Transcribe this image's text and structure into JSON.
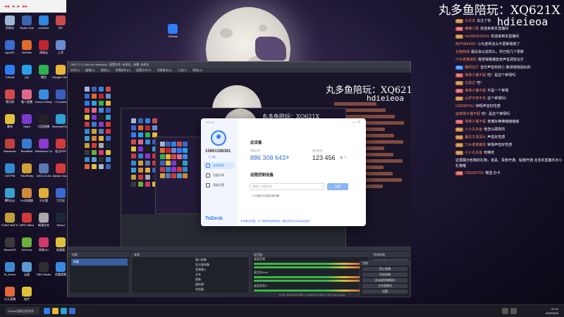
{
  "media_tab": {
    "controls": [
      "◂◂",
      "◂",
      "▸",
      "▸▸"
    ]
  },
  "wallpaper": {
    "title": "丸多鱼陪玩：XQ621X",
    "subtitle": "hdieieoa"
  },
  "desktop_icons": [
    {
      "label": "回收站",
      "color": "#9fb7d6"
    },
    {
      "label": "Studio One",
      "color": "#3c64b0"
    },
    {
      "label": "cccMeet",
      "color": "#2f85e0"
    },
    {
      "label": "MP",
      "color": "#c94c4c"
    },
    {
      "label": "ZyphRT",
      "color": "#3a6acb"
    },
    {
      "label": "WeStlm",
      "color": "#e06a2c"
    },
    {
      "label": "网易云",
      "color": "#c0262d"
    },
    {
      "label": "上传",
      "color": "#6a8bd0"
    },
    {
      "label": "ToDesk",
      "color": "#2e7cf6"
    },
    {
      "label": "QQ",
      "color": "#2aa0e8"
    },
    {
      "label": "微信",
      "color": "#2fb34e"
    },
    {
      "label": "Google Chrome",
      "color": "#e8b43a"
    },
    {
      "label": "雪天网",
      "color": "#d04a4a"
    },
    {
      "label": "看人直播",
      "color": "#e06a8b"
    },
    {
      "label": "Draw & Bluep",
      "color": "#3a8ee0"
    },
    {
      "label": "i Connect",
      "color": "#3a5fc0"
    },
    {
      "label": "雷电",
      "color": "#e0c23a"
    },
    {
      "label": "Hight",
      "color": "#7a3ad0"
    },
    {
      "label": "抖音直播",
      "color": "#222"
    },
    {
      "label": "Microsoft Edge",
      "color": "#2fa0d0"
    },
    {
      "label": "Bandicam",
      "color": "#c04040"
    },
    {
      "label": "Bandibelt",
      "color": "#3a7ad0"
    },
    {
      "label": "Bandicam Cut",
      "color": "#8a3ad0"
    },
    {
      "label": "金山PDF",
      "color": "#d03a3a"
    },
    {
      "label": "CMTPM",
      "color": "#2f8ad0"
    },
    {
      "label": "ThirdParty",
      "color": "#d0a03a"
    },
    {
      "label": "2022-10-04",
      "color": "#5a7ab0"
    },
    {
      "label": "Adobe Cloud",
      "color": "#d03a3a"
    },
    {
      "label": "腾讯QQ",
      "color": "#3aa0d0"
    },
    {
      "label": "UU加速器",
      "color": "#d08a3a"
    },
    {
      "label": "天天看",
      "color": "#e0b03a"
    },
    {
      "label": "工作宝",
      "color": "#3a6ad0"
    },
    {
      "label": "PUBG BATTLEGR",
      "color": "#c0a03a"
    },
    {
      "label": "WPS Office",
      "color": "#d03a3a"
    },
    {
      "label": "新建文本",
      "color": "#aaa"
    },
    {
      "label": "Steam",
      "color": "#1b2838"
    },
    {
      "label": "SteamVR",
      "color": "#3a3a3a"
    },
    {
      "label": "GeForce",
      "color": "#6ab03a"
    },
    {
      "label": "网易UU",
      "color": "#d03a6a"
    },
    {
      "label": "加速器",
      "color": "#e0c03a"
    },
    {
      "label": "Hi_Demo",
      "color": "#3a8ad0"
    },
    {
      "label": "云盘",
      "color": "#5a9ad0"
    },
    {
      "label": "OBS Studio",
      "color": "#302e31"
    },
    {
      "label": "优酷视频",
      "color": "#3a8ae0"
    },
    {
      "label": "久久直播",
      "color": "#e06a3a"
    },
    {
      "label": "软件",
      "color": "#e0c23a"
    }
  ],
  "obs": {
    "title": "OBS 27.2.4 (64 bit, windows) - 配置文件: 未命名 - 场景: 未命名",
    "menu": [
      "文件(F)",
      "编辑(E)",
      "视图(V)",
      "停靠部件(D)",
      "配置文件(P)",
      "场景集合(S)",
      "工具(T)",
      "帮助(H)"
    ],
    "panels": {
      "scenes": "场景",
      "sources": "来源",
      "mixer": "混音器",
      "transitions": "转场特效",
      "controls": "控制"
    },
    "scene_list": [
      "场景"
    ],
    "source_list": [
      "窗口采集",
      "显示器采集",
      "音频输入",
      "文本",
      "图像",
      "媒体源",
      "浏览器"
    ],
    "mixer_tracks": [
      "桌面音频",
      "麦克风/Aux",
      "桌面音频 2"
    ],
    "transition": "淡入淡出",
    "duration_label": "时长",
    "duration_value": "300 ms",
    "controls": [
      "停止直播",
      "开始录制",
      "启动虚拟摄像机",
      "工作室模式",
      "设置",
      "退出"
    ],
    "status": "LIVE: 00:00:00   REC: 00:00:00   CPU: 1.2%, 60.00 fps"
  },
  "nested_overlay": {
    "title": "丸多鱼陪玩：XQ621X",
    "subtitle": "hdieieoa"
  },
  "todesk": {
    "title": "ToDesk",
    "phone": "15661168361",
    "tag": "个人版",
    "nav": [
      "远程协助",
      "设备列表",
      "高级设置"
    ],
    "logo": "ToDesk",
    "this_device": "此设备",
    "device_code_label": "设备代码",
    "device_code": "886 308 643",
    "temp_pw_label": "临时密码",
    "temp_pw": "123 456",
    "remote_label": "远程控制设备",
    "input_placeholder": "请输入设备代码",
    "connect_btn": "连接",
    "status_text": "已就绪 可连接远程设备",
    "footer": "本设备已连接，为了更好的远程体验，建议开启ToDesk后台运行"
  },
  "chat": {
    "top_overlay": "丸多鱼陪玩：XQ621X",
    "top_sub": "hdieieoa",
    "rows": [
      {
        "badge": "粉丝",
        "user": "大乐天",
        "text": "关注了你",
        "badge_color": "#c07a2a"
      },
      {
        "badge": "贵族",
        "user": "嘟嘟小姬",
        "text": "欢迎来到本直播间",
        "badge_color": "#d04a4a"
      },
      {
        "badge": "粉丝",
        "user": "ren2821618191",
        "text": "欢迎来到本直播间",
        "badge_color": "#c07a2a"
      },
      {
        "badge": "",
        "user": "用户6842497",
        "text": "小丸老师怎么不更新视频了",
        "badge_color": "#888"
      },
      {
        "badge": "",
        "user": "北绝西城",
        "text": "最近会以这样么，你已经几个更新",
        "badge_color": "#888"
      },
      {
        "badge": "",
        "user": "乃木老婆御前",
        "text": "我觉得像播音克声音调音在打",
        "badge_color": "#888"
      },
      {
        "badge": "粉丝",
        "user": "路邦在打",
        "text": "音乐声音有些小 像讲悄悄话似的",
        "badge_color": "#2e7cf6"
      },
      {
        "badge": "粉丝",
        "user": "菲菲子播不超",
        "text": "哇！是这个钟情吗",
        "badge_color": "#d04a4a"
      },
      {
        "badge": "粉丝",
        "user": "北逸达",
        "text": "哇！",
        "badge_color": "#c07a2a"
      },
      {
        "badge": "粉丝",
        "user": "菲菲子播不超",
        "text": "不是一个钟情",
        "badge_color": "#d04a4a"
      },
      {
        "badge": "粉丝",
        "user": "山学不管不多",
        "text": "这个钟情吗！",
        "badge_color": "#c07a2a"
      },
      {
        "badge": "",
        "user": "CA5S8YOU",
        "text": "钟情声音好性感",
        "badge_color": "#888"
      },
      {
        "badge": "",
        "user": "@菲菲子播不超",
        "text": "哇！是这个钟情吗",
        "badge_color": "#888"
      },
      {
        "badge": "粉丝",
        "user": "菲菲子播不超",
        "text": "老婆好棒棒啵啵啵啵",
        "badge_color": "#d04a4a"
      },
      {
        "badge": "粉丝",
        "user": "小小丸多鱼",
        "text": "他怎么顾样的",
        "badge_color": "#c07a2a"
      },
      {
        "badge": "粉丝",
        "user": "暮氏方深深大",
        "text": "声音好性感",
        "badge_color": "#c07a2a"
      },
      {
        "badge": "粉丝",
        "user": "乃木老婆御前",
        "text": "钟情声音好性感",
        "badge_color": "#c07a2a"
      },
      {
        "badge": "粉丝",
        "user": "小小丸多鱼",
        "text": "有嘛欢",
        "badge_color": "#c07a2a"
      }
    ],
    "system_msg": "这很展示色物的礼物，道具、贵族开通、粘帽开通 点活本直播手办小礼物哦",
    "last_row": {
      "badge": "贵族",
      "user": "CASS8YOU",
      "text": "赠送 办卡",
      "badge_color": "#d04a4a"
    }
  },
  "taskbar": {
    "search": "ToDesk智能远程协作",
    "time": "21:12",
    "date": "2022/9/23"
  }
}
